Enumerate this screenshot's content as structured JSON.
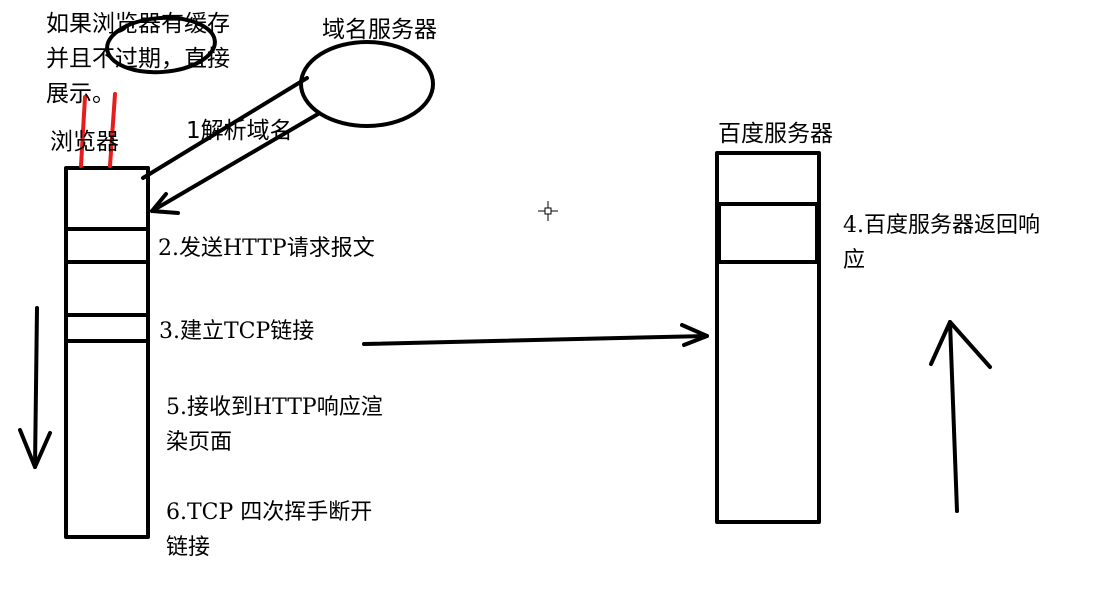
{
  "diagram": {
    "cache_note": [
      "如果浏览器有缓存",
      "并且不过期，直接",
      "展示。"
    ],
    "dns_label": "域名服务器",
    "browser_label": "浏览器",
    "resolve_label": "1解析域名",
    "server_label": "百度服务器",
    "steps": {
      "send_request": "2.发送HTTP请求报文",
      "tcp_connect": "3.建立TCP链接",
      "receive_render": [
        "5.接收到HTTP响应渲",
        "染页面"
      ],
      "tcp_close": [
        "6.TCP 四次挥手断开",
        "链接"
      ],
      "server_response": [
        "4.百度服务器返回响",
        "应"
      ]
    },
    "colors": {
      "ink": "#000000",
      "highlight": "#e81c1c",
      "background": "#ffffff"
    }
  }
}
